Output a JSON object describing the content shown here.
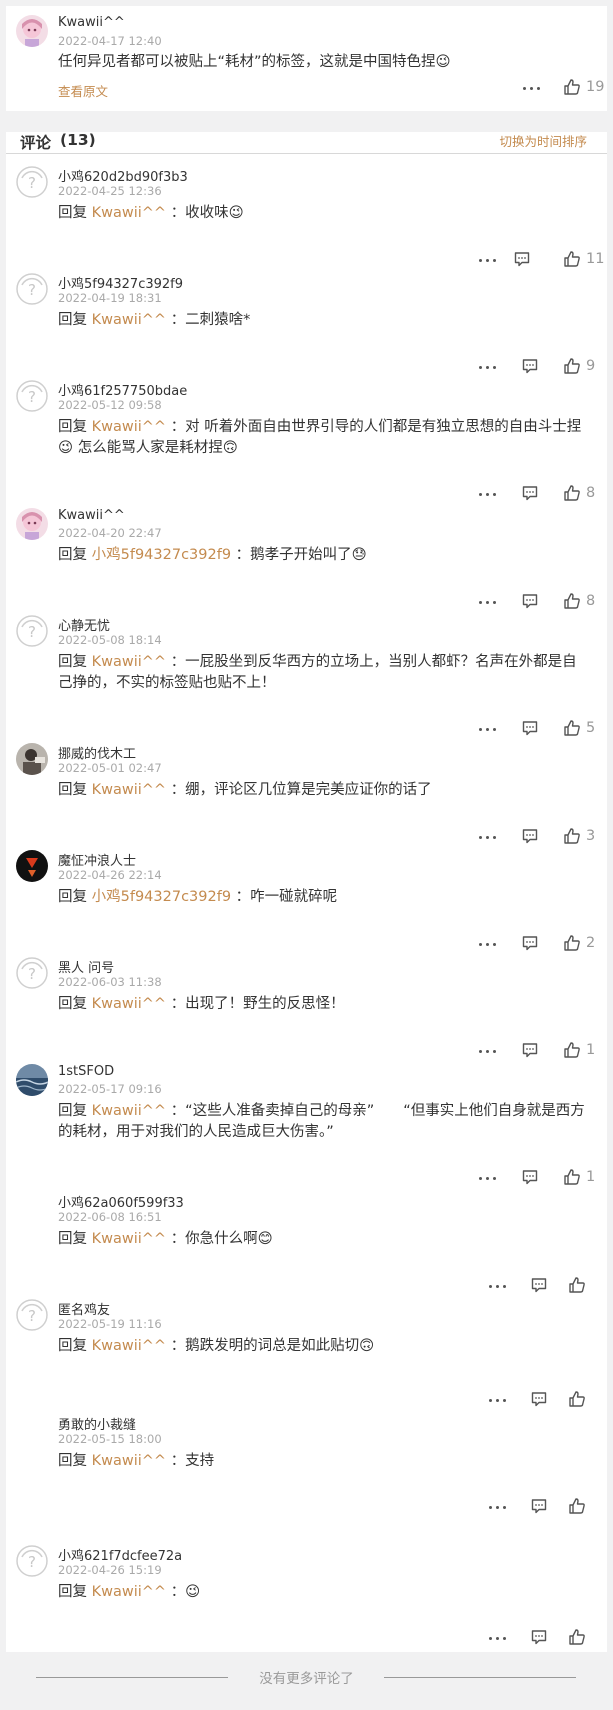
{
  "post": {
    "username": "Kwawii^^",
    "time": "2022-04-17 12:40",
    "text": "任何异见者都可以被贴上“耗材”的标签，这就是中国特色捏😉",
    "view_original": "查看原文",
    "likes": "19"
  },
  "comments_header": {
    "title": "评论",
    "count": "(13)",
    "sort_toggle": "切换为时间排序"
  },
  "reply_word": "回复",
  "comments": [
    {
      "username": "小鸡620d2bd90f3b3",
      "time": "2022-04-25 12:36",
      "reply_to": "Kwawii^^",
      "text": "：收收味😉",
      "likes": "11"
    },
    {
      "username": "小鸡5f94327c392f9",
      "time": "2022-04-19 18:31",
      "reply_to": "Kwawii^^",
      "text": "：二刺猿啥*",
      "likes": "9"
    },
    {
      "username": "小鸡61f257750bdae",
      "time": "2022-05-12 09:58",
      "reply_to": "Kwawii^^",
      "text": "：对 听着外面自由世界引导的人们都是有独立思想的自由斗士捏 😉 怎么能骂人家是耗材捏🙃",
      "likes": "8"
    },
    {
      "username": "Kwawii^^",
      "time": "2022-04-20 22:47",
      "reply_to": "小鸡5f94327c392f9",
      "text": "：鹅孝子开始叫了😓",
      "likes": "8"
    },
    {
      "username": "心静无忧",
      "time": "2022-05-08 18:14",
      "reply_to": "Kwawii^^",
      "text": "：一屁股坐到反华西方的立场上，当别人都虾？名声在外都是自己挣的，不实的标签贴也贴不上！",
      "likes": "5"
    },
    {
      "username": "挪威的伐木工",
      "time": "2022-05-01 02:47",
      "reply_to": "Kwawii^^",
      "text": "：绷，评论区几位算是完美应证你的话了",
      "likes": "3"
    },
    {
      "username": "魔怔冲浪人士",
      "time": "2022-04-26 22:14",
      "reply_to": "小鸡5f94327c392f9",
      "text": "：咋一碰就碎呢",
      "likes": "2"
    },
    {
      "username": "黑人 问号",
      "time": "2022-06-03 11:38",
      "reply_to": "Kwawii^^",
      "text": "：出现了！野生的反思怪！",
      "likes": "1"
    },
    {
      "username": "1stSFOD",
      "time": "2022-05-17 09:16",
      "reply_to": "Kwawii^^",
      "text": "：“这些人准备卖掉自己的母亲”　　“但事实上他们自身就是西方的耗材，用于对我们的人民造成巨大伤害。”",
      "likes": "1"
    },
    {
      "username": "小鸡62a060f599f33",
      "time": "2022-06-08 16:51",
      "reply_to": "Kwawii^^",
      "text": "：你急什么啊😊",
      "likes": ""
    },
    {
      "username": "匿名鸡友",
      "time": "2022-05-19 11:16",
      "reply_to": "Kwawii^^",
      "text": "：鹅跌发明的词总是如此贴切🙃",
      "likes": ""
    },
    {
      "username": "勇敢的小裁缝",
      "time": "2022-05-15 18:00",
      "reply_to": "Kwawii^^",
      "text": "：支持",
      "likes": ""
    },
    {
      "username": "小鸡621f7dcfee72a",
      "time": "2022-04-26 15:19",
      "reply_to": "Kwawii^^",
      "text": "：😉",
      "likes": ""
    }
  ],
  "footer_text": "没有更多评论了",
  "colors": {
    "accent": "#c48b4f",
    "meta": "#a9a9a9",
    "background": "#f1f1f2"
  }
}
